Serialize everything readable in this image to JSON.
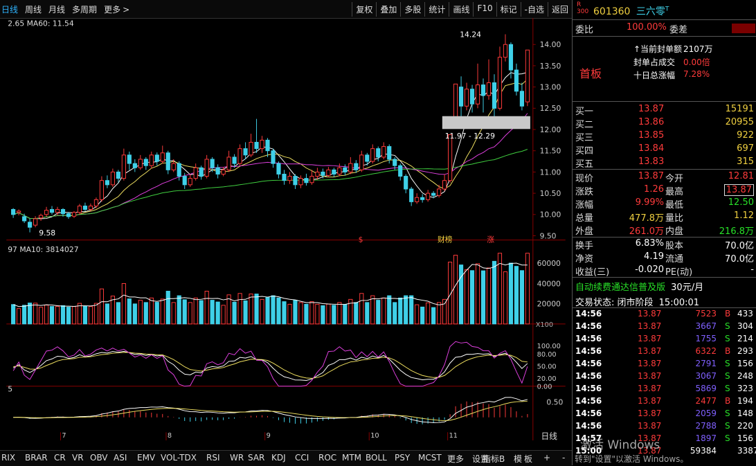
{
  "toolbar": {
    "left": [
      "日线",
      "周线",
      "月线",
      "多周期",
      "更多"
    ],
    "right": [
      "复权",
      "叠加",
      "多股",
      "统计",
      "画线",
      "F10",
      "标记",
      "-自选",
      "返回"
    ]
  },
  "legend": {
    "ma_main": "2.65  MA60: 11.54",
    "vol": "97  MA10: 3814027",
    "macd_prefix": "5"
  },
  "annotations": {
    "high": "14.24",
    "low": "9.58",
    "band": "11.97 - 12.29",
    "events": [
      "$",
      "财榜",
      "涨"
    ],
    "vol_unit": "X100"
  },
  "chart_data": {
    "type": "candlestick",
    "price_axis": [
      "14.00",
      "13.50",
      "13.00",
      "12.50",
      "12.00",
      "11.50",
      "11.00",
      "10.50",
      "10.00",
      "9.50"
    ],
    "volume_axis": [
      "60000",
      "40000",
      "20000"
    ],
    "kdj_axis": [
      "100.00",
      "80.00",
      "50.00",
      "20.00",
      "0.00"
    ],
    "macd_axis": [
      "0.50"
    ],
    "month_ticks": [
      "7",
      "8",
      "9",
      "10",
      "11"
    ],
    "ylim": [
      9.4,
      14.4
    ],
    "candles": [
      {
        "o": 10.12,
        "c": 10.0,
        "h": 10.15,
        "l": 9.92
      },
      {
        "o": 10.05,
        "c": 10.08,
        "h": 10.12,
        "l": 9.98
      },
      {
        "o": 9.95,
        "c": 9.85,
        "h": 10.02,
        "l": 9.8
      },
      {
        "o": 9.82,
        "c": 9.7,
        "h": 9.9,
        "l": 9.58
      },
      {
        "o": 9.75,
        "c": 9.9,
        "h": 9.96,
        "l": 9.7
      },
      {
        "o": 9.92,
        "c": 9.98,
        "h": 10.02,
        "l": 9.85
      },
      {
        "o": 10.0,
        "c": 10.1,
        "h": 10.18,
        "l": 9.95
      },
      {
        "o": 10.12,
        "c": 10.05,
        "h": 10.2,
        "l": 10.0
      },
      {
        "o": 10.05,
        "c": 10.12,
        "h": 10.18,
        "l": 9.98
      },
      {
        "o": 10.12,
        "c": 10.02,
        "h": 10.15,
        "l": 9.95
      },
      {
        "o": 10.02,
        "c": 9.95,
        "h": 10.06,
        "l": 9.9
      },
      {
        "o": 9.96,
        "c": 10.05,
        "h": 10.08,
        "l": 9.92
      },
      {
        "o": 10.05,
        "c": 10.2,
        "h": 10.25,
        "l": 10.0
      },
      {
        "o": 10.2,
        "c": 10.12,
        "h": 10.28,
        "l": 10.08
      },
      {
        "o": 10.12,
        "c": 10.2,
        "h": 10.26,
        "l": 10.08
      },
      {
        "o": 10.2,
        "c": 10.35,
        "h": 10.4,
        "l": 10.15
      },
      {
        "o": 10.35,
        "c": 10.8,
        "h": 10.9,
        "l": 10.3
      },
      {
        "o": 10.8,
        "c": 10.7,
        "h": 10.92,
        "l": 10.62
      },
      {
        "o": 10.7,
        "c": 11.0,
        "h": 11.08,
        "l": 10.65
      },
      {
        "o": 11.0,
        "c": 10.85,
        "h": 11.05,
        "l": 10.75
      },
      {
        "o": 10.85,
        "c": 11.4,
        "h": 11.55,
        "l": 10.8
      },
      {
        "o": 11.4,
        "c": 11.2,
        "h": 11.48,
        "l": 11.05
      },
      {
        "o": 11.2,
        "c": 11.1,
        "h": 11.3,
        "l": 11.0
      },
      {
        "o": 11.1,
        "c": 11.3,
        "h": 11.4,
        "l": 11.05
      },
      {
        "o": 11.3,
        "c": 11.15,
        "h": 11.35,
        "l": 11.05
      },
      {
        "o": 11.15,
        "c": 11.4,
        "h": 11.48,
        "l": 11.08
      },
      {
        "o": 11.4,
        "c": 11.25,
        "h": 11.46,
        "l": 11.15
      },
      {
        "o": 11.25,
        "c": 11.45,
        "h": 11.62,
        "l": 11.2
      },
      {
        "o": 11.45,
        "c": 11.05,
        "h": 11.5,
        "l": 10.95
      },
      {
        "o": 11.05,
        "c": 11.2,
        "h": 11.3,
        "l": 11.0
      },
      {
        "o": 11.2,
        "c": 10.9,
        "h": 11.25,
        "l": 10.8
      },
      {
        "o": 10.9,
        "c": 10.7,
        "h": 10.98,
        "l": 10.6
      },
      {
        "o": 10.7,
        "c": 10.85,
        "h": 10.95,
        "l": 10.65
      },
      {
        "o": 10.85,
        "c": 11.1,
        "h": 11.2,
        "l": 10.8
      },
      {
        "o": 11.1,
        "c": 10.9,
        "h": 11.15,
        "l": 10.82
      },
      {
        "o": 10.9,
        "c": 11.3,
        "h": 11.4,
        "l": 10.85
      },
      {
        "o": 11.3,
        "c": 11.1,
        "h": 11.35,
        "l": 11.0
      },
      {
        "o": 11.1,
        "c": 10.95,
        "h": 11.18,
        "l": 10.85
      },
      {
        "o": 10.95,
        "c": 11.05,
        "h": 11.12,
        "l": 10.9
      },
      {
        "o": 11.05,
        "c": 11.35,
        "h": 11.5,
        "l": 11.0
      },
      {
        "o": 11.35,
        "c": 11.2,
        "h": 11.42,
        "l": 11.1
      },
      {
        "o": 11.2,
        "c": 11.55,
        "h": 11.65,
        "l": 11.15
      },
      {
        "o": 11.55,
        "c": 11.4,
        "h": 11.7,
        "l": 11.3
      },
      {
        "o": 11.4,
        "c": 11.7,
        "h": 11.9,
        "l": 11.35
      },
      {
        "o": 11.7,
        "c": 11.55,
        "h": 12.25,
        "l": 11.45
      },
      {
        "o": 11.55,
        "c": 11.75,
        "h": 11.85,
        "l": 11.45
      },
      {
        "o": 11.75,
        "c": 11.5,
        "h": 11.8,
        "l": 11.35
      },
      {
        "o": 11.5,
        "c": 11.2,
        "h": 11.55,
        "l": 11.1
      },
      {
        "o": 11.2,
        "c": 10.95,
        "h": 11.25,
        "l": 10.85
      },
      {
        "o": 10.95,
        "c": 10.8,
        "h": 11.05,
        "l": 10.7
      },
      {
        "o": 10.8,
        "c": 10.9,
        "h": 11.0,
        "l": 10.72
      },
      {
        "o": 10.9,
        "c": 10.7,
        "h": 10.95,
        "l": 10.6
      },
      {
        "o": 10.7,
        "c": 10.85,
        "h": 10.92,
        "l": 10.62
      },
      {
        "o": 10.85,
        "c": 10.75,
        "h": 10.96,
        "l": 10.68
      },
      {
        "o": 10.75,
        "c": 10.9,
        "h": 11.05,
        "l": 10.7
      },
      {
        "o": 10.9,
        "c": 11.0,
        "h": 11.1,
        "l": 10.82
      },
      {
        "o": 11.0,
        "c": 10.92,
        "h": 11.08,
        "l": 10.85
      },
      {
        "o": 10.92,
        "c": 11.05,
        "h": 11.12,
        "l": 10.88
      },
      {
        "o": 11.05,
        "c": 10.95,
        "h": 11.1,
        "l": 10.88
      },
      {
        "o": 10.95,
        "c": 11.1,
        "h": 11.2,
        "l": 10.9
      },
      {
        "o": 11.1,
        "c": 11.0,
        "h": 11.18,
        "l": 10.92
      },
      {
        "o": 11.0,
        "c": 11.2,
        "h": 11.35,
        "l": 10.95
      },
      {
        "o": 11.2,
        "c": 11.05,
        "h": 11.28,
        "l": 10.98
      },
      {
        "o": 11.05,
        "c": 11.4,
        "h": 11.5,
        "l": 11.0
      },
      {
        "o": 11.4,
        "c": 11.25,
        "h": 11.45,
        "l": 11.15
      },
      {
        "o": 11.25,
        "c": 11.55,
        "h": 11.65,
        "l": 11.2
      },
      {
        "o": 11.55,
        "c": 11.35,
        "h": 11.6,
        "l": 11.25
      },
      {
        "o": 11.35,
        "c": 11.6,
        "h": 11.7,
        "l": 11.3
      },
      {
        "o": 11.6,
        "c": 11.3,
        "h": 11.65,
        "l": 11.2
      },
      {
        "o": 11.3,
        "c": 11.15,
        "h": 11.35,
        "l": 11.05
      },
      {
        "o": 11.15,
        "c": 10.9,
        "h": 11.2,
        "l": 10.8
      },
      {
        "o": 10.9,
        "c": 10.6,
        "h": 10.95,
        "l": 10.5
      },
      {
        "o": 10.6,
        "c": 10.3,
        "h": 10.65,
        "l": 10.2
      },
      {
        "o": 10.3,
        "c": 10.4,
        "h": 10.5,
        "l": 10.25
      },
      {
        "o": 10.4,
        "c": 10.35,
        "h": 10.48,
        "l": 10.28
      },
      {
        "o": 10.35,
        "c": 10.5,
        "h": 10.58,
        "l": 10.3
      },
      {
        "o": 10.5,
        "c": 10.45,
        "h": 10.55,
        "l": 10.38
      },
      {
        "o": 10.45,
        "c": 10.6,
        "h": 10.7,
        "l": 10.4
      },
      {
        "o": 10.6,
        "c": 10.8,
        "h": 10.95,
        "l": 10.55
      },
      {
        "o": 10.8,
        "c": 11.88,
        "h": 11.88,
        "l": 10.75
      },
      {
        "o": 12.15,
        "c": 13.07,
        "h": 13.07,
        "l": 12.1
      },
      {
        "o": 13.0,
        "c": 12.55,
        "h": 13.25,
        "l": 12.3
      },
      {
        "o": 12.55,
        "c": 12.95,
        "h": 13.1,
        "l": 12.45
      },
      {
        "o": 12.95,
        "c": 12.6,
        "h": 13.05,
        "l": 12.4
      },
      {
        "o": 12.6,
        "c": 13.05,
        "h": 13.55,
        "l": 12.5
      },
      {
        "o": 13.05,
        "c": 12.8,
        "h": 13.2,
        "l": 12.4
      },
      {
        "o": 12.8,
        "c": 13.1,
        "h": 13.65,
        "l": 12.7
      },
      {
        "o": 13.1,
        "c": 12.5,
        "h": 13.3,
        "l": 12.3
      },
      {
        "o": 12.5,
        "c": 13.7,
        "h": 13.95,
        "l": 12.45
      },
      {
        "o": 13.7,
        "c": 14.0,
        "h": 14.24,
        "l": 13.6
      },
      {
        "o": 14.0,
        "c": 13.4,
        "h": 14.05,
        "l": 13.2
      },
      {
        "o": 13.4,
        "c": 12.9,
        "h": 13.55,
        "l": 12.8
      },
      {
        "o": 12.9,
        "c": 12.55,
        "h": 13.1,
        "l": 12.45
      },
      {
        "o": 12.65,
        "c": 13.87,
        "h": 13.87,
        "l": 12.55
      }
    ]
  },
  "quote": {
    "code": "601360",
    "name": "三六零",
    "name_sup": "T",
    "badge_top": "R",
    "badge_bottom": "300",
    "webi_label": "委比",
    "webi_value": "100.00%",
    "weicha_label": "委差",
    "board_label": "首板",
    "seal_rows": [
      {
        "label": "↑当前封单额",
        "value": "2107万"
      },
      {
        "label": "封单占成交",
        "value": "0.00倍"
      },
      {
        "label": "十日总涨幅",
        "value": "7.28%"
      }
    ],
    "bids": [
      {
        "label": "买一",
        "price": "13.87",
        "vol": "15191"
      },
      {
        "label": "买二",
        "price": "13.86",
        "vol": "20955"
      },
      {
        "label": "买三",
        "price": "13.85",
        "vol": "922"
      },
      {
        "label": "买四",
        "price": "13.84",
        "vol": "697"
      },
      {
        "label": "买五",
        "price": "13.83",
        "vol": "315"
      }
    ],
    "stats": [
      {
        "l1": "现价",
        "v1": "13.87",
        "l2": "今开",
        "v2": "12.81"
      },
      {
        "l1": "涨跌",
        "v1": "1.26",
        "l2": "最高",
        "v2": "13.87"
      },
      {
        "l1": "涨幅",
        "v1": "9.99%",
        "l2": "最低",
        "v2": "12.50"
      },
      {
        "l1": "总量",
        "v1": "477.8万",
        "l2": "量比",
        "v2": "1.12"
      },
      {
        "l1": "外盘",
        "v1": "261.0万",
        "l2": "内盘",
        "v2": "216.8万"
      }
    ],
    "stats2": [
      {
        "l1": "换手",
        "v1": "6.83%",
        "l2": "股本",
        "v2": "70.0亿"
      },
      {
        "l1": "净资",
        "v1": "4.19",
        "l2": "流通",
        "v2": "70.0亿"
      },
      {
        "l1": "收益(三)",
        "v1": "-0.020",
        "l2": "PE(动)",
        "v2": "-"
      }
    ],
    "promo": "自动续费通达信普及版",
    "promo_price": "30元/月",
    "status_label": "交易状态: 闭市阶段",
    "status_time": "15:00:01",
    "ticks": [
      {
        "t": "14:56",
        "p": "13.87",
        "v": "7523",
        "s": "B",
        "n": "433"
      },
      {
        "t": "14:56",
        "p": "13.87",
        "v": "3667",
        "s": "S",
        "n": "304"
      },
      {
        "t": "14:56",
        "p": "13.87",
        "v": "1755",
        "s": "S",
        "n": "214"
      },
      {
        "t": "14:56",
        "p": "13.87",
        "v": "6322",
        "s": "B",
        "n": "293"
      },
      {
        "t": "14:56",
        "p": "13.87",
        "v": "2791",
        "s": "S",
        "n": "156"
      },
      {
        "t": "14:56",
        "p": "13.87",
        "v": "3067",
        "s": "S",
        "n": "248"
      },
      {
        "t": "14:56",
        "p": "13.87",
        "v": "5869",
        "s": "S",
        "n": "323"
      },
      {
        "t": "14:56",
        "p": "13.87",
        "v": "2477",
        "s": "B",
        "n": "194"
      },
      {
        "t": "14:56",
        "p": "13.87",
        "v": "2059",
        "s": "S",
        "n": "148"
      },
      {
        "t": "14:56",
        "p": "13.87",
        "v": "2788",
        "s": "S",
        "n": "220"
      },
      {
        "t": "14:57",
        "p": "13.87",
        "v": "1897",
        "s": "S",
        "n": "156"
      },
      {
        "t": "15:00",
        "p": "13.87",
        "v": "59384",
        "s": "",
        "n": "3387"
      }
    ]
  },
  "bottom_tabs": [
    "RIX",
    "BRAR",
    "CR",
    "VR",
    "OBV",
    "ASI",
    "EMV",
    "VOL-TDX",
    "RSI",
    "WR",
    "SAR",
    "KDJ",
    "CCI",
    "ROC",
    "MTM",
    "BOLL",
    "PSY",
    "MCST",
    "更多",
    "设置"
  ],
  "bottom_right": [
    "指标B",
    "模",
    "板",
    "+",
    "-"
  ],
  "period_label": "日线",
  "watermark": {
    "line1": "激活 Windows",
    "line2": "转到\"设置\"以激活 Windows。"
  },
  "colors": {
    "up": "#ff3b3b",
    "down": "#3fd0e8",
    "ma5": "#ffffff",
    "ma10": "#f0e060",
    "ma20": "#e040e0",
    "ma60": "#40d040"
  }
}
